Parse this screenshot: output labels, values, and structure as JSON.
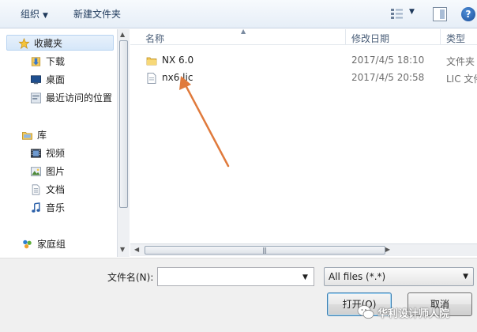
{
  "toolbar": {
    "organize_label": "组织",
    "new_folder_label": "新建文件夹",
    "help_label": "?"
  },
  "nav": {
    "favorites_label": "收藏夹",
    "downloads_label": "下载",
    "desktop_label": "桌面",
    "recent_label": "最近访问的位置",
    "libraries_label": "库",
    "videos_label": "视频",
    "pictures_label": "图片",
    "documents_label": "文档",
    "music_label": "音乐",
    "homegroup_label": "家庭组"
  },
  "columns": {
    "name": "名称",
    "date": "修改日期",
    "type": "类型"
  },
  "files": [
    {
      "name": "NX 6.0",
      "date": "2017/4/5 18:10",
      "type": "文件夹",
      "icon": "folder-icon"
    },
    {
      "name": "nx6.lic",
      "date": "2017/4/5 20:58",
      "type": "LIC 文件",
      "icon": "document-icon"
    }
  ],
  "bottom": {
    "filename_label": "文件名(N):",
    "filename_value": "",
    "filetype_value": "All files (*.*)",
    "open_label": "打开(O)",
    "cancel_label": "取消"
  },
  "watermark": {
    "text": "华利设计师人院"
  },
  "colors": {
    "accent": "#1e395b",
    "arrow": "#e07a3c"
  }
}
